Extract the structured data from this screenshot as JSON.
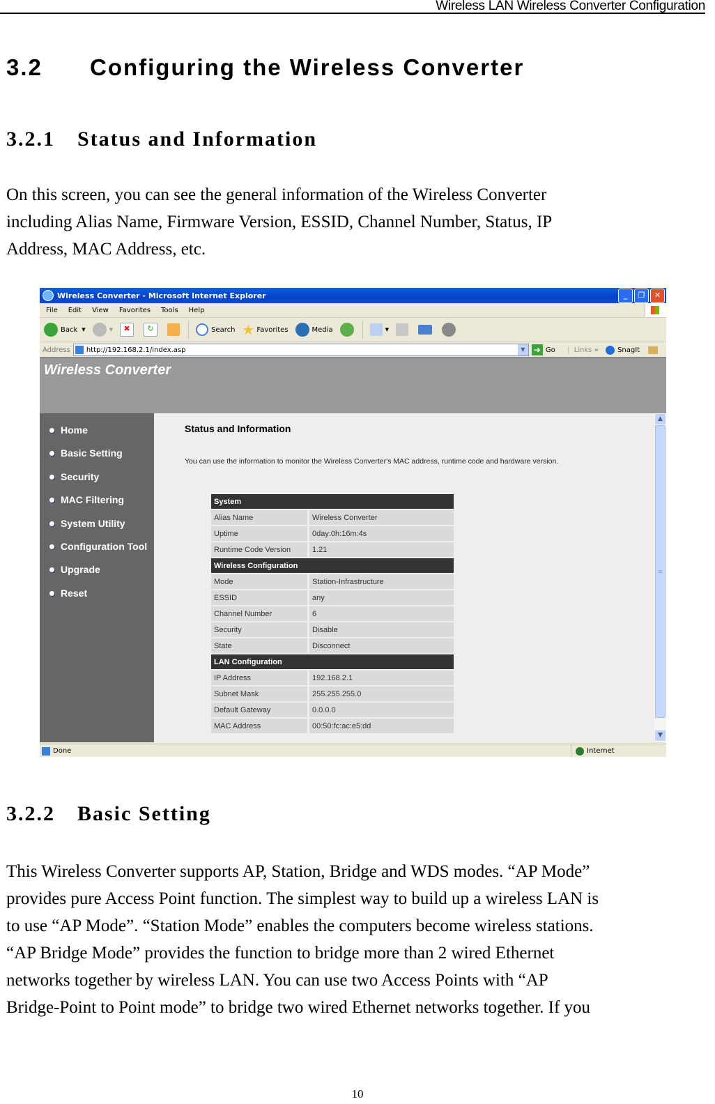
{
  "doc": {
    "running_header": "Wireless LAN Wireless Converter Configuration",
    "section": {
      "number": "3.2",
      "title": "Configuring the Wireless Converter"
    },
    "subsection1": {
      "number": "3.2.1",
      "title": "Status and Information"
    },
    "para1_lines": [
      "On this screen, you can see the general information of the Wireless Converter",
      "including Alias Name, Firmware Version, ESSID, Channel Number, Status, IP",
      "Address, MAC Address, etc."
    ],
    "subsection2": {
      "number": "3.2.2",
      "title": "Basic Setting"
    },
    "para2_lines": [
      "This Wireless Converter supports AP, Station, Bridge and WDS modes. “AP Mode”",
      "provides pure Access Point function. The simplest way to build up a wireless LAN is",
      "to use “AP Mode”. “Station Mode” enables the computers become wireless stations.",
      "“AP Bridge Mode” provides the function to bridge more than 2 wired Ethernet",
      "networks together by wireless LAN. You can use two Access Points with “AP",
      "Bridge-Point to Point mode” to bridge two wired Ethernet networks together. If you"
    ],
    "page_number": "10"
  },
  "browser": {
    "window_title": "Wireless Converter - Microsoft Internet Explorer",
    "menu": [
      "File",
      "Edit",
      "View",
      "Favorites",
      "Tools",
      "Help"
    ],
    "toolbar": {
      "back": "Back",
      "search": "Search",
      "favorites": "Favorites",
      "media": "Media"
    },
    "address_label": "Address",
    "url": "http://192.168.2.1/index.asp",
    "go": "Go",
    "links": "Links",
    "links_more": "»",
    "snagit": "SnagIt",
    "status_text": "Done",
    "zone": "Internet"
  },
  "webpage": {
    "brand": "Wireless Converter",
    "nav": [
      "Home",
      "Basic Setting",
      "Security",
      "MAC Filtering",
      "System Utility",
      "Configuration Tool",
      "Upgrade",
      "Reset"
    ],
    "title": "Status and Information",
    "description": "You can use the information to monitor the Wireless Converter's MAC address, runtime code and hardware version.",
    "sections": [
      {
        "header": "System",
        "rows": [
          {
            "label": "Alias Name",
            "value": "Wireless Converter"
          },
          {
            "label": "Uptime",
            "value": "0day:0h:16m:4s"
          },
          {
            "label": "Runtime Code Version",
            "value": "1.21"
          }
        ]
      },
      {
        "header": "Wireless Configuration",
        "rows": [
          {
            "label": "Mode",
            "value": "Station-Infrastructure"
          },
          {
            "label": "ESSID",
            "value": "any"
          },
          {
            "label": "Channel Number",
            "value": "6"
          },
          {
            "label": "Security",
            "value": "Disable"
          },
          {
            "label": "State",
            "value": "Disconnect"
          }
        ]
      },
      {
        "header": "LAN Configuration",
        "rows": [
          {
            "label": "IP Address",
            "value": "192.168.2.1"
          },
          {
            "label": "Subnet Mask",
            "value": "255.255.255.0"
          },
          {
            "label": "Default Gateway",
            "value": "0.0.0.0"
          },
          {
            "label": "MAC Address",
            "value": "00:50:fc:ac:e5:dd"
          }
        ]
      }
    ]
  }
}
